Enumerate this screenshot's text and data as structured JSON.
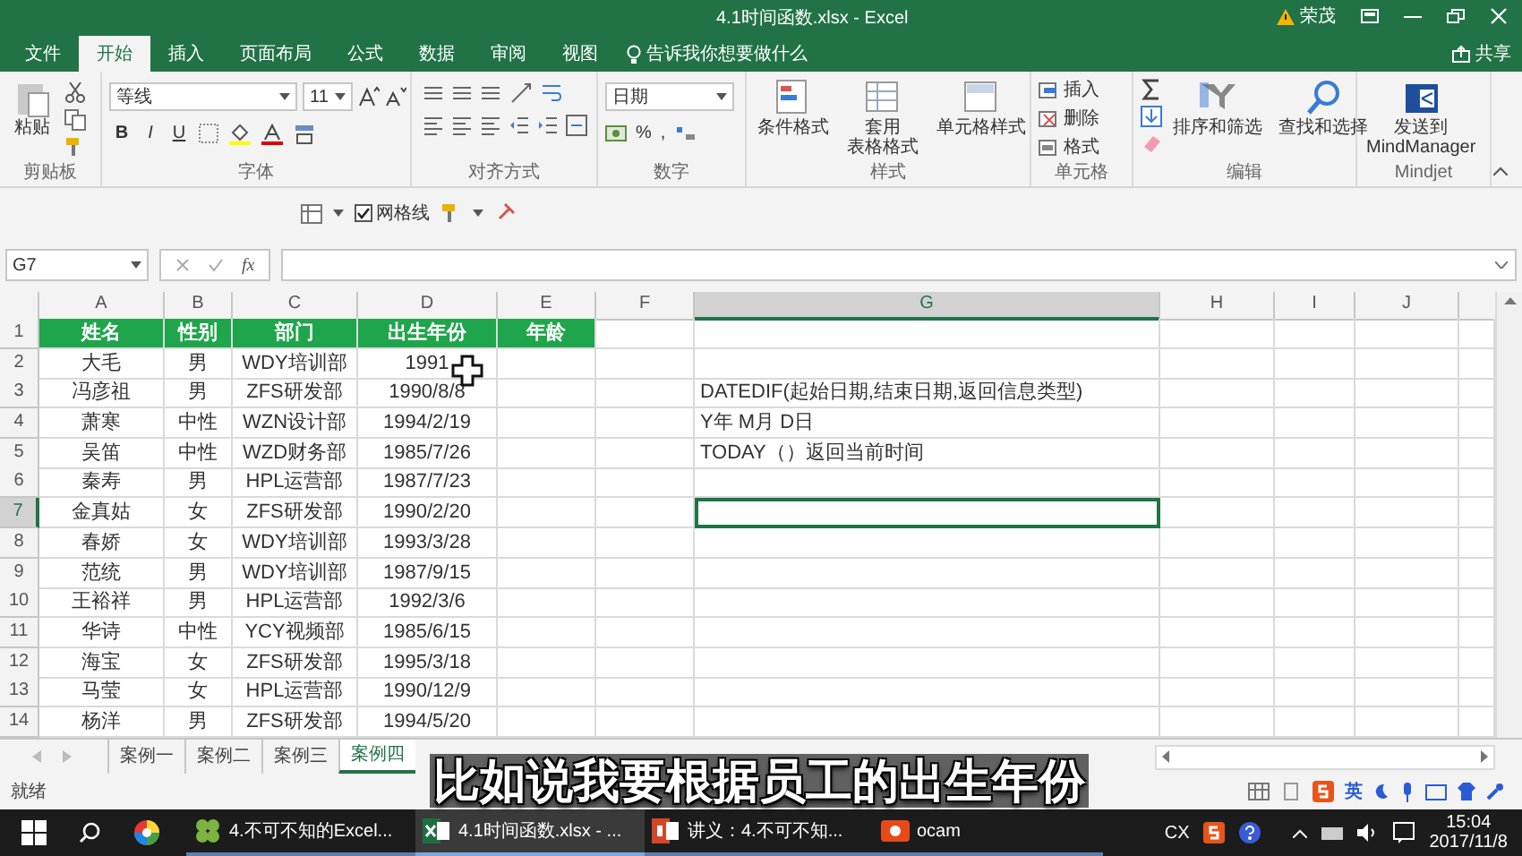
{
  "window": {
    "title": "4.1时间函数.xlsx - Excel",
    "user": "荣茂"
  },
  "ribbon_tabs": [
    {
      "label": "文件",
      "selected": false
    },
    {
      "label": "开始",
      "selected": true
    },
    {
      "label": "插入",
      "selected": false
    },
    {
      "label": "页面布局",
      "selected": false
    },
    {
      "label": "公式",
      "selected": false
    },
    {
      "label": "数据",
      "selected": false
    },
    {
      "label": "审阅",
      "selected": false
    },
    {
      "label": "视图",
      "selected": false
    }
  ],
  "tell_me": "告诉我你想要做什么",
  "share": "共享",
  "ribbon_groups": [
    {
      "kind": "clipboard",
      "label": "剪贴板",
      "buttons": [
        {
          "lines": [
            "粘贴"
          ]
        }
      ]
    },
    {
      "kind": "font",
      "label": "字体",
      "font_name": "等线",
      "font_size": "11",
      "format_buttons": [
        "B",
        "I",
        "U"
      ]
    },
    {
      "kind": "alignment",
      "label": "对齐方式"
    },
    {
      "kind": "number",
      "label": "数字",
      "format": "日期",
      "symbols": [
        "%",
        ","
      ]
    },
    {
      "kind": "styles",
      "label": "样式",
      "buttons": [
        {
          "lines": [
            "条件格式"
          ]
        },
        {
          "lines": [
            "套用",
            "表格格式"
          ]
        },
        {
          "lines": [
            "单元格样式"
          ]
        }
      ]
    },
    {
      "kind": "cells",
      "label": "单元格",
      "buttons": [
        {
          "lines": [
            "插入"
          ]
        },
        {
          "lines": [
            "删除"
          ]
        },
        {
          "lines": [
            "格式"
          ]
        }
      ]
    },
    {
      "kind": "editing",
      "label": "编辑",
      "buttons": [
        {
          "lines": [
            "排序和筛选"
          ]
        },
        {
          "lines": [
            "查找和选择"
          ]
        }
      ]
    },
    {
      "kind": "addin",
      "label": "Mindjet",
      "buttons": [
        {
          "lines": [
            "发送到",
            "MindManager"
          ]
        }
      ]
    }
  ],
  "quick_toolbar": {
    "gridlines": {
      "label": "网格线",
      "checked": true
    }
  },
  "formula_bar": {
    "name_box": "G7",
    "function_label": "fx"
  },
  "sheet": {
    "columns": [
      {
        "label": "A",
        "selected": false
      },
      {
        "label": "B",
        "selected": false
      },
      {
        "label": "C",
        "selected": false
      },
      {
        "label": "D",
        "selected": false
      },
      {
        "label": "E",
        "selected": false
      },
      {
        "label": "F",
        "selected": false
      },
      {
        "label": "G",
        "selected": true
      },
      {
        "label": "H",
        "selected": false
      },
      {
        "label": "I",
        "selected": false
      },
      {
        "label": "J",
        "selected": false
      }
    ],
    "rows": [
      {
        "number": "1",
        "selected": false,
        "kind": "header",
        "cells": [
          "姓名",
          "性别",
          "部门",
          "出生年份",
          "年龄"
        ]
      },
      {
        "number": "2",
        "selected": false,
        "kind": "data",
        "cells": [
          "大毛",
          "男",
          "WDY培训部",
          "1991"
        ]
      },
      {
        "number": "3",
        "selected": false,
        "kind": "data",
        "cells": [
          "冯彦祖",
          "男",
          "ZFS研发部",
          "1990/8/8"
        ],
        "note": "DATEDIF(起始日期,结束日期,返回信息类型)"
      },
      {
        "number": "4",
        "selected": false,
        "kind": "data",
        "cells": [
          "萧寒",
          "中性",
          "WZN设计部",
          "1994/2/19"
        ],
        "note": "Y年 M月 D日"
      },
      {
        "number": "5",
        "selected": false,
        "kind": "data",
        "cells": [
          "吴笛",
          "中性",
          "WZD财务部",
          "1985/7/26"
        ],
        "note": "TODAY（）返回当前时间"
      },
      {
        "number": "6",
        "selected": false,
        "kind": "data",
        "cells": [
          "秦寿",
          "男",
          "HPL运营部",
          "1987/7/23"
        ]
      },
      {
        "number": "7",
        "selected": true,
        "kind": "data",
        "cells": [
          "金真姑",
          "女",
          "ZFS研发部",
          "1990/2/20"
        ]
      },
      {
        "number": "8",
        "selected": false,
        "kind": "data",
        "cells": [
          "春娇",
          "女",
          "WDY培训部",
          "1993/3/28"
        ]
      },
      {
        "number": "9",
        "selected": false,
        "kind": "data",
        "cells": [
          "范统",
          "男",
          "WDY培训部",
          "1987/9/15"
        ]
      },
      {
        "number": "10",
        "selected": false,
        "kind": "data",
        "cells": [
          "王裕祥",
          "男",
          "HPL运营部",
          "1992/3/6"
        ]
      },
      {
        "number": "11",
        "selected": false,
        "kind": "data",
        "cells": [
          "华诗",
          "中性",
          "YCY视频部",
          "1985/6/15"
        ]
      },
      {
        "number": "12",
        "selected": false,
        "kind": "data",
        "cells": [
          "海宝",
          "女",
          "ZFS研发部",
          "1995/3/18"
        ]
      },
      {
        "number": "13",
        "selected": false,
        "kind": "data",
        "cells": [
          "马莹",
          "女",
          "HPL运营部",
          "1990/12/9"
        ]
      },
      {
        "number": "14",
        "selected": false,
        "kind": "data",
        "cells": [
          "杨洋",
          "男",
          "ZFS研发部",
          "1994/5/20"
        ]
      }
    ]
  },
  "sheet_tabs": [
    {
      "label": "案例一",
      "selected": false
    },
    {
      "label": "案例二",
      "selected": false
    },
    {
      "label": "案例三",
      "selected": false
    },
    {
      "label": "案例四",
      "selected": true
    }
  ],
  "status_bar": {
    "text": "就绪",
    "ime_mode": "英"
  },
  "subtitle": "比如说我要根据员工的出生年份",
  "taskbar": {
    "apps": [
      {
        "kind": "clover",
        "label": "4.不可不知的Excel...",
        "active": false
      },
      {
        "kind": "excel",
        "label": "4.1时间函数.xlsx - ...",
        "active": true
      },
      {
        "kind": "powerpoint",
        "label": "讲义：4.不可不知...",
        "active": false
      },
      {
        "kind": "ocam",
        "label": "ocam",
        "active": false
      }
    ],
    "ime": "CX",
    "time": "15:04",
    "date": "2017/11/8"
  }
}
